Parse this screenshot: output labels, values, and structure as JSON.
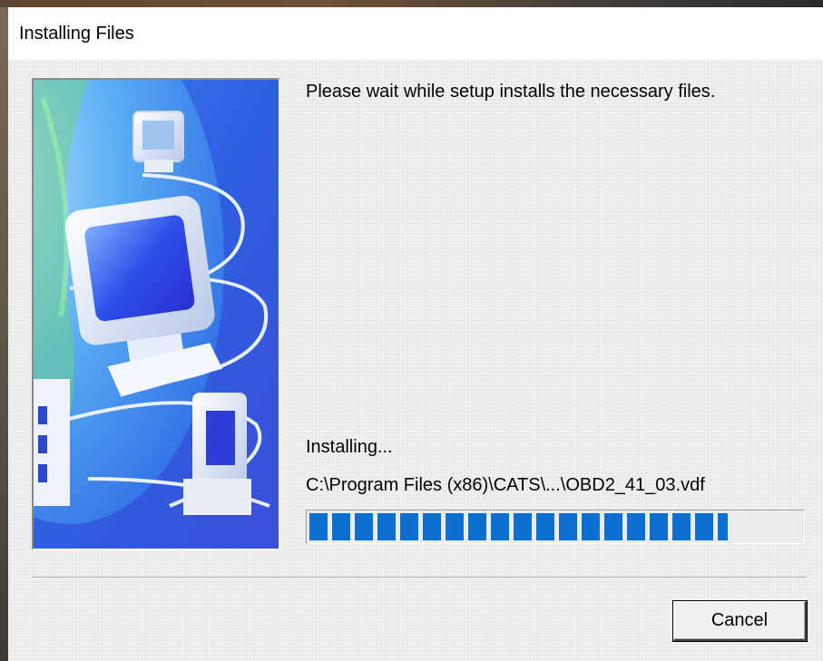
{
  "window": {
    "title": "Installing Files"
  },
  "main": {
    "message": "Please wait while setup installs the necessary files.",
    "status": "Installing...",
    "current_file": "C:\\Program Files (x86)\\CATS\\...\\OBD2_41_03.vdf",
    "progress_fraction": 0.85
  },
  "buttons": {
    "cancel_label": "Cancel"
  },
  "colors": {
    "progress_block": "#0a6fd0",
    "dialog_background": "#ededed",
    "banner_blue": "#2f5fe0"
  },
  "icons": {
    "banner": "installer-illustration-computers-network"
  }
}
